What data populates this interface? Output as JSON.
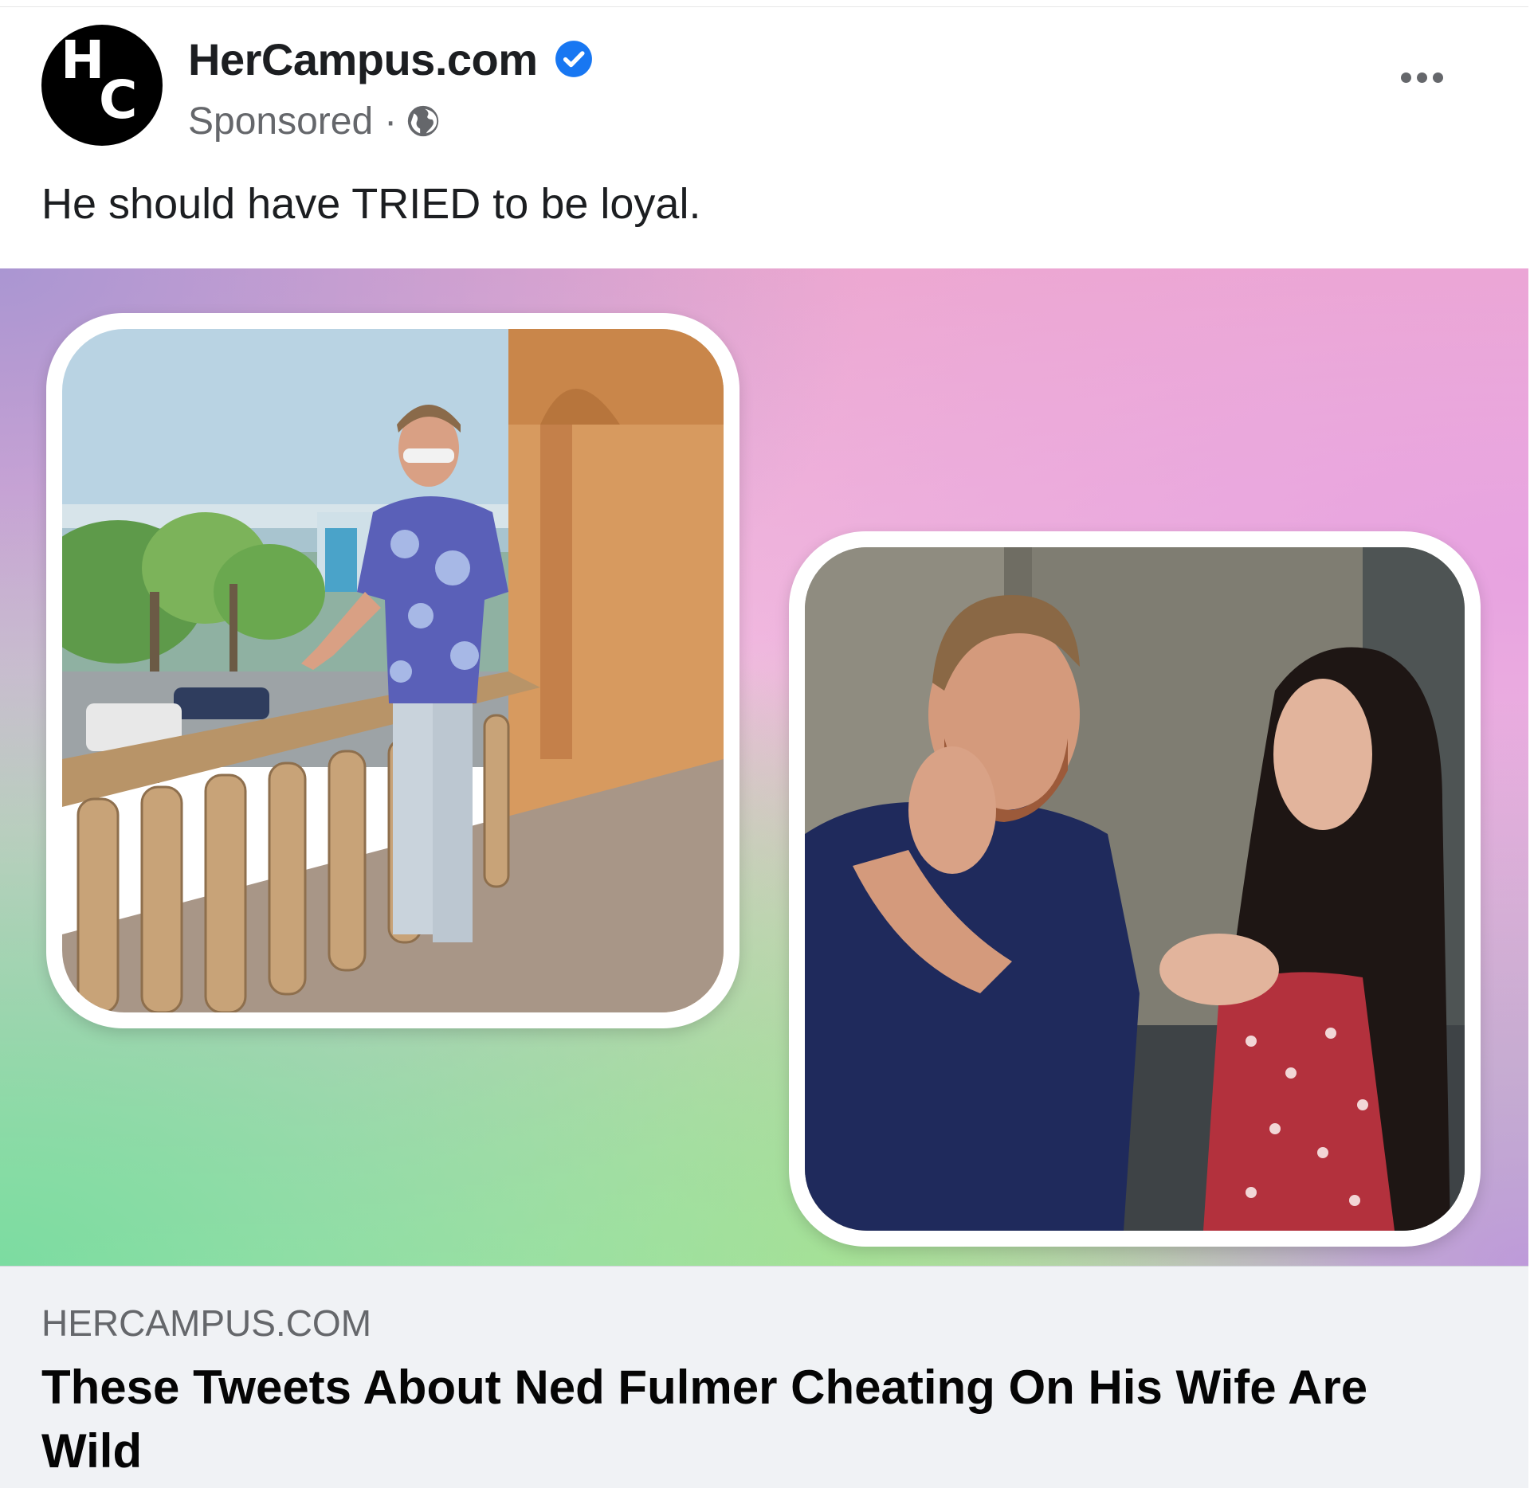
{
  "post": {
    "page_name": "HerCampus.com",
    "avatar_letters": {
      "top": "H",
      "bottom": "C"
    },
    "verified_icon": "verified-badge-icon",
    "sponsored_label": "Sponsored",
    "separator": "·",
    "audience_icon": "globe-icon",
    "more_icon": "more-options-icon",
    "caption": "He should have TRIED to be loyal."
  },
  "media": {
    "left_image": "man-on-balcony-photo",
    "right_image": "couple-laughing-photo"
  },
  "link": {
    "domain": "HERCAMPUS.COM",
    "headline": "These Tweets About Ned Fulmer Cheating On His Wife Are Wild"
  },
  "colors": {
    "verified_blue": "#1877f2",
    "secondary_text": "#65676b",
    "link_bg": "#f0f2f5"
  }
}
